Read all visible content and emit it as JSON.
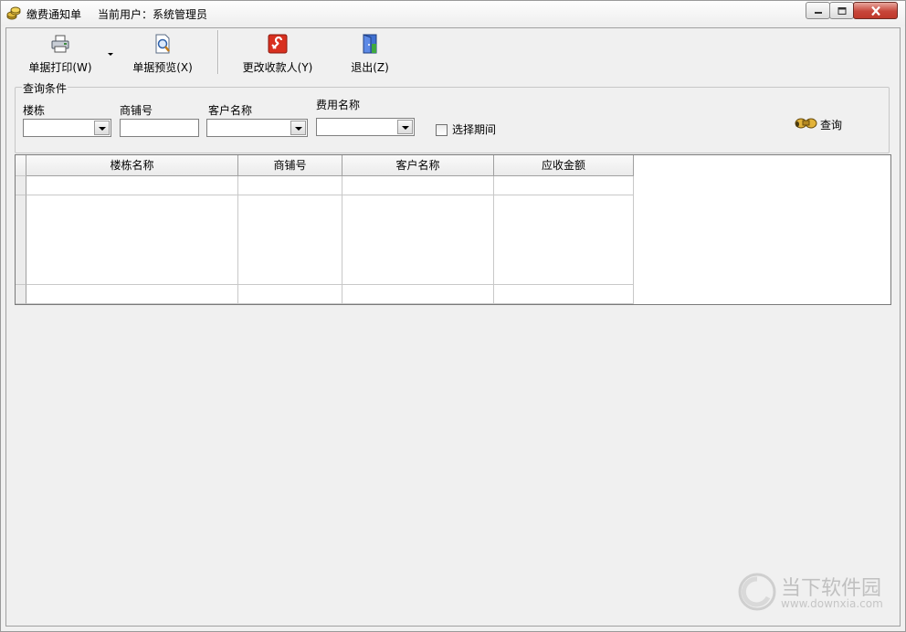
{
  "window": {
    "title": "缴费通知单",
    "current_user": "当前用户：系统管理员"
  },
  "toolbar": {
    "print_label": "单据打印(W)",
    "preview_label": "单据预览(X)",
    "change_payee_label": "更改收款人(Y)",
    "exit_label": "退出(Z)"
  },
  "query": {
    "group_title": "查询条件",
    "building_label": "楼栋",
    "shop_no_label": "商铺号",
    "customer_label": "客户名称",
    "fee_label": "费用名称",
    "period_label": "选择期间",
    "search_label": "查询",
    "building_value": "",
    "shop_no_value": "",
    "customer_value": "",
    "fee_value": ""
  },
  "grid": {
    "columns": [
      "楼栋名称",
      "商铺号",
      "客户名称",
      "应收金额"
    ],
    "rows": []
  },
  "watermark": {
    "name": "当下软件园",
    "url": "www.downxia.com"
  },
  "icons": {
    "app": "coins-icon",
    "print": "printer-icon",
    "preview": "magnifier-document-icon",
    "change_payee": "red-wrench-icon",
    "exit": "door-exit-icon",
    "search": "binoculars-icon"
  }
}
